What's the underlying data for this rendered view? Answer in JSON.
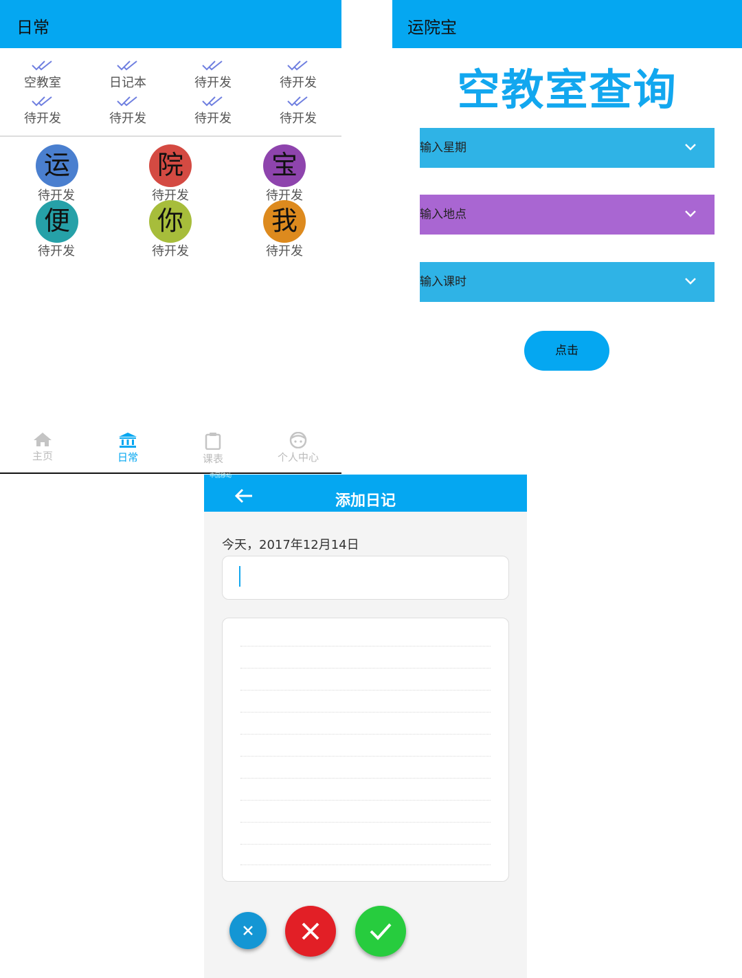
{
  "panel_daily": {
    "title": "日常",
    "quick_items": [
      {
        "label": "空教室",
        "icon": "double-check-icon"
      },
      {
        "label": "日记本",
        "icon": "double-check-icon"
      },
      {
        "label": "待开发",
        "icon": "double-check-icon"
      },
      {
        "label": "待开发",
        "icon": "double-check-icon"
      },
      {
        "label": "待开发",
        "icon": "double-check-icon"
      },
      {
        "label": "待开发",
        "icon": "double-check-icon"
      },
      {
        "label": "待开发",
        "icon": "double-check-icon"
      },
      {
        "label": "待开发",
        "icon": "double-check-icon"
      }
    ],
    "circle_items": [
      {
        "char": "运",
        "label": "待开发",
        "color": "#4a7fcf"
      },
      {
        "char": "院",
        "label": "待开发",
        "color": "#d44a42"
      },
      {
        "char": "宝",
        "label": "待开发",
        "color": "#8e44ad"
      },
      {
        "char": "便",
        "label": "待开发",
        "color": "#26a1a8"
      },
      {
        "char": "你",
        "label": "待开发",
        "color": "#a7bd3b"
      },
      {
        "char": "我",
        "label": "待开发",
        "color": "#dd8a1e"
      }
    ],
    "bottom_nav": [
      {
        "label": "主页",
        "icon": "home-icon",
        "active": false
      },
      {
        "label": "日常",
        "icon": "bank-icon",
        "active": true
      },
      {
        "label": "课表",
        "icon": "clipboard-icon",
        "active": false
      },
      {
        "label": "个人中心",
        "icon": "face-icon",
        "active": false
      }
    ]
  },
  "panel_query": {
    "app_title": "运院宝",
    "heading": "空教室查询",
    "selects": [
      {
        "label": "输入星期",
        "color": "#2fb3e6"
      },
      {
        "label": "输入地点",
        "color": "#a966d2"
      },
      {
        "label": "输入课时",
        "color": "#2fb3e6"
      }
    ],
    "button": "点击"
  },
  "panel_diary": {
    "carrier": "中国移动",
    "title": "添加日记",
    "date_text": "今天，2017年12月14日",
    "title_value": "",
    "body_value": "",
    "fab_colors": {
      "small": "#1496d4",
      "cancel": "#e21f26",
      "confirm": "#27cc3e"
    }
  }
}
